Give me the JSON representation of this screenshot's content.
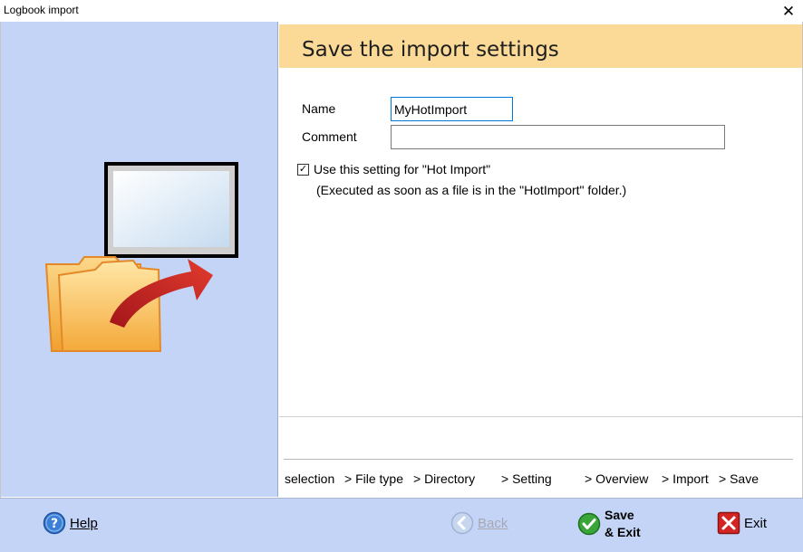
{
  "window": {
    "title": "Logbook import",
    "close_glyph": "✕"
  },
  "header": {
    "heading": "Save the import settings"
  },
  "form": {
    "name_label": "Name",
    "name_value": "MyHotImport",
    "comment_label": "Comment",
    "comment_value": "",
    "hot_import_checked": true,
    "hot_import_label": "Use this setting for \"Hot Import\"",
    "hot_import_note": "(Executed as soon as a file is in the \"HotImport\" folder.)"
  },
  "steps": [
    "selection",
    "> File type",
    "> Directory",
    "> Setting",
    "> Overview",
    "> Import",
    "> Save"
  ],
  "buttons": {
    "help": "Help",
    "back": "Back",
    "save_line1": "Save",
    "save_line2": "& Exit",
    "exit": "Exit"
  },
  "icons": {
    "illustration": "folder-to-monitor-arrow-icon",
    "help": "help-question-icon",
    "back": "back-arrow-icon",
    "save": "checkmark-icon",
    "exit": "exit-x-icon",
    "close": "close-icon"
  },
  "colors": {
    "panel_blue": "#c3d4f6",
    "header_band": "#fbd996",
    "focus_border": "#0078d7"
  }
}
